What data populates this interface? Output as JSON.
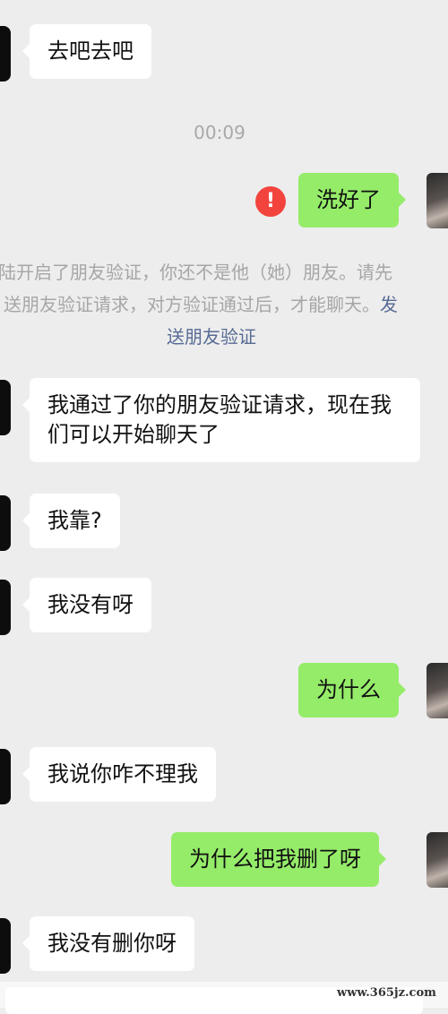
{
  "messages": [
    {
      "dir": "in",
      "text": "去吧去吧"
    },
    {
      "dir": "out",
      "text": "洗好了"
    },
    {
      "dir": "in",
      "text": "我通过了你的朋友验证请求，现在我们可以开始聊天了"
    },
    {
      "dir": "in",
      "text": "我靠?"
    },
    {
      "dir": "in",
      "text": "我没有呀"
    },
    {
      "dir": "out",
      "text": "为什么"
    },
    {
      "dir": "in",
      "text": "我说你咋不理我"
    },
    {
      "dir": "out",
      "text": "为什么把我删了呀"
    },
    {
      "dir": "in",
      "text": "我没有删你呀"
    }
  ],
  "timestamp": "00:09",
  "error_icon": {
    "glyph": "!",
    "color": "#f2443d"
  },
  "system_notice": {
    "line1": "陆开启了朋友验证，你还不是他（她）朋友。请先",
    "line2_text": "送朋友验证请求，对方验证通过后，才能聊天。",
    "line2_link": "发",
    "line3_link": "送朋友验证"
  },
  "watermark": "www.365jz.com",
  "colors": {
    "background": "#ededed",
    "outgoing_bubble": "#95ec69",
    "incoming_bubble": "#ffffff",
    "link": "#576b95",
    "notice_text": "#a6a6a6"
  }
}
